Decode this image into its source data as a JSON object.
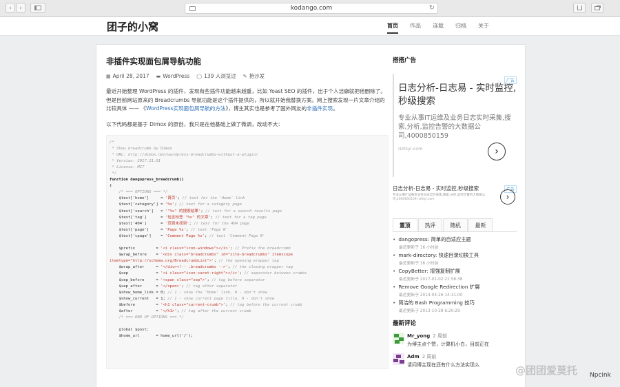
{
  "browser": {
    "url": "kodango.com",
    "back_icon": "‹",
    "forward_icon": "›",
    "reload_icon": "↻"
  },
  "site": {
    "logo": "团子的小窝",
    "nav": [
      {
        "label": "首页",
        "active": true
      },
      {
        "label": "作品",
        "active": false
      },
      {
        "label": "连载",
        "active": false
      },
      {
        "label": "归档",
        "active": false
      },
      {
        "label": "关于",
        "active": false
      }
    ]
  },
  "post": {
    "title": "非插件实现面包屑导航功能",
    "date": "April 28, 2017",
    "category": "WordPress",
    "views": "139 人浏览过",
    "comment": "抢沙发",
    "para1_a": "最近开始整理 WordPress 的插件，发现有些插件功能越来越重，比如 Yoast SEO 的插件，出于个人洁癖就把他删除了。但是目前网站原来的 Breadcrumbs 导航功能是这个插件提供的，所以就开始我替换方案。网上搜索发现一片文章介绍的比较具体 —— 《",
    "para1_link1": "WordPress实现面包屑导航的方法",
    "para1_b": "》，博主其实也是参考了国外网友的",
    "para1_link2": "非插件实现",
    "para1_c": "。",
    "para2": "以下代码都是基于 Dimox 的原创，我只是在他基础上做了微调，改动不大："
  },
  "sidebar": {
    "ad_title": "搭搭广告",
    "ad_tag": "广告",
    "ad1": {
      "headline": "日志分析-日志易 - 实时监控,秒级搜索",
      "desc": "专业从事IT运维及业务日志实时采集,搜索,分析,监控告警的大数据公司,4000850159",
      "url": "rizhiyi.com"
    },
    "ad2": {
      "headline": "日志分析-日志易 - 实时监控,秒级搜索",
      "desc": "专业从事IT运维及业务日志实时采集,搜索,分析,监控告警的大数据公司,4000850159 rizhiyi.com"
    },
    "tabs": [
      {
        "label": "置顶",
        "active": true
      },
      {
        "label": "热评",
        "active": false
      },
      {
        "label": "随机",
        "active": false
      },
      {
        "label": "最新",
        "active": false
      }
    ],
    "posts": [
      {
        "title": "dangopress: 简单的自适应主题",
        "updated": "最近更新于 16 小时前"
      },
      {
        "title": "mark-directory: 快速目录切换工具",
        "updated": "最近更新于 16 小时前"
      },
      {
        "title": "CopyBetter: 增强复制扩展",
        "updated": "最近更新于 2017-01-02 21:58:38"
      },
      {
        "title": "Remove Google Redirection 扩展",
        "updated": "最近更新于 2014-04-26 14:31:00"
      },
      {
        "title": "简洁的 Bash Programming 技巧",
        "updated": "最近更新于 2013-10-28 6:20:29"
      }
    ],
    "comments_title": "最新评论",
    "comments": [
      {
        "name": "Mr_yong",
        "time": "2 周前",
        "text": "为博主点个赞，计算机小白，目前正在"
      },
      {
        "name": "Adm",
        "time": "2 周前",
        "text": "请问博主现在还有什么方法实现么"
      }
    ]
  },
  "watermark": {
    "text": "@团团爱莫托",
    "sub": "Npcink"
  }
}
